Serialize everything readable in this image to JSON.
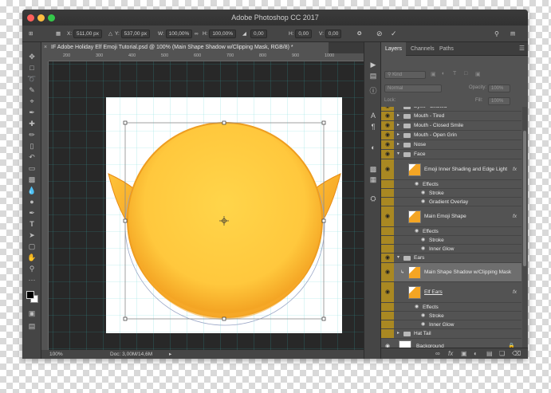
{
  "window": {
    "title": "Adobe Photoshop CC 2017",
    "traffic_colors": [
      "#fc605c",
      "#fdbc40",
      "#34c84a"
    ]
  },
  "options_bar": {
    "x_label": "X:",
    "x_value": "511,00 px",
    "y_label": "Y:",
    "y_value": "537,00 px",
    "w_label": "W:",
    "w_value": "100,00%",
    "h_label": "H:",
    "h_value": "100,00%",
    "angle_value": "0,00",
    "hskew_label": "H:",
    "hskew_value": "0,00",
    "vskew_label": "V:",
    "vskew_value": "0,00",
    "icons": [
      "move-options-icon",
      "reference-point-icon",
      "warp-icon",
      "cancel-transform-icon",
      "commit-transform-icon",
      "search-icon",
      "workspace-icon"
    ]
  },
  "document": {
    "tab_title": "IF Adobe Holiday Elf Emoji Tutorial.psd @ 100% (Main Shape Shadow w/Clipping Mask, RGB/8) *",
    "zoom": "100%",
    "doc_size": "Doc: 3,00M/14,6M",
    "ruler_labels": [
      "200",
      "300",
      "400",
      "500",
      "600",
      "700",
      "800",
      "900",
      "1000"
    ]
  },
  "tools": [
    "move",
    "marquee",
    "lasso",
    "quick-select",
    "crop",
    "eyedropper",
    "healing",
    "brush",
    "stamp",
    "history-brush",
    "eraser",
    "gradient",
    "blur",
    "dodge",
    "pen",
    "type",
    "path-select",
    "rectangle",
    "hand",
    "zoom",
    "more"
  ],
  "panel": {
    "tabs": [
      "Layers",
      "Channels",
      "Paths"
    ],
    "filter_kind": "Kind",
    "blend_mode": "Normal",
    "opacity_label": "Opacity:",
    "opacity_value": "100%",
    "lock_label": "Lock:",
    "fill_label": "Fill:",
    "fill_value": "100%",
    "layers": [
      {
        "name": "Eyes - Excited",
        "kind": "group"
      },
      {
        "name": "Mouth - Tired",
        "kind": "group"
      },
      {
        "name": "Mouth - Closed Smile",
        "kind": "group"
      },
      {
        "name": "Mouth - Open Grin",
        "kind": "group"
      },
      {
        "name": "Nose",
        "kind": "group"
      },
      {
        "name": "Face",
        "kind": "group-open"
      },
      {
        "name": "Emoji Inner Shading and Edge Light",
        "kind": "layer-fx",
        "fx": "fx"
      },
      {
        "name": "Effects",
        "kind": "effects-header"
      },
      {
        "name": "Stroke",
        "kind": "effect"
      },
      {
        "name": "Gradient Overlay",
        "kind": "effect"
      },
      {
        "name": "Main Emoji Shape",
        "kind": "layer-fx",
        "fx": "fx"
      },
      {
        "name": "Effects",
        "kind": "effects-header"
      },
      {
        "name": "Stroke",
        "kind": "effect"
      },
      {
        "name": "Inner Glow",
        "kind": "effect"
      },
      {
        "name": "Ears",
        "kind": "group-open"
      },
      {
        "name": "Main Shape Shadow w/Clipping Mask",
        "kind": "layer-selected"
      },
      {
        "name": "Elf Ears",
        "kind": "layer-fx",
        "fx": "fx"
      },
      {
        "name": "Effects",
        "kind": "effects-header"
      },
      {
        "name": "Stroke",
        "kind": "effect"
      },
      {
        "name": "Inner Glow",
        "kind": "effect"
      },
      {
        "name": "Hat Tail",
        "kind": "group"
      },
      {
        "name": "Background",
        "kind": "background"
      }
    ],
    "footer_icons": [
      "link-icon",
      "fx-icon",
      "mask-icon",
      "adjustment-icon",
      "folder-icon",
      "new-layer-icon",
      "trash-icon"
    ]
  },
  "strip_icons": [
    "play-icon",
    "history-icon",
    "info-icon",
    "character-icon",
    "paragraph-icon",
    "color-icon",
    "swatches-icon",
    "adjustments-icon",
    "properties-icon"
  ],
  "colors": {
    "eye_column": "#a98822",
    "emoji_fill": "#ffc83d",
    "emoji_shade": "#f4a524",
    "selected_layer": "#6e6e6e"
  }
}
